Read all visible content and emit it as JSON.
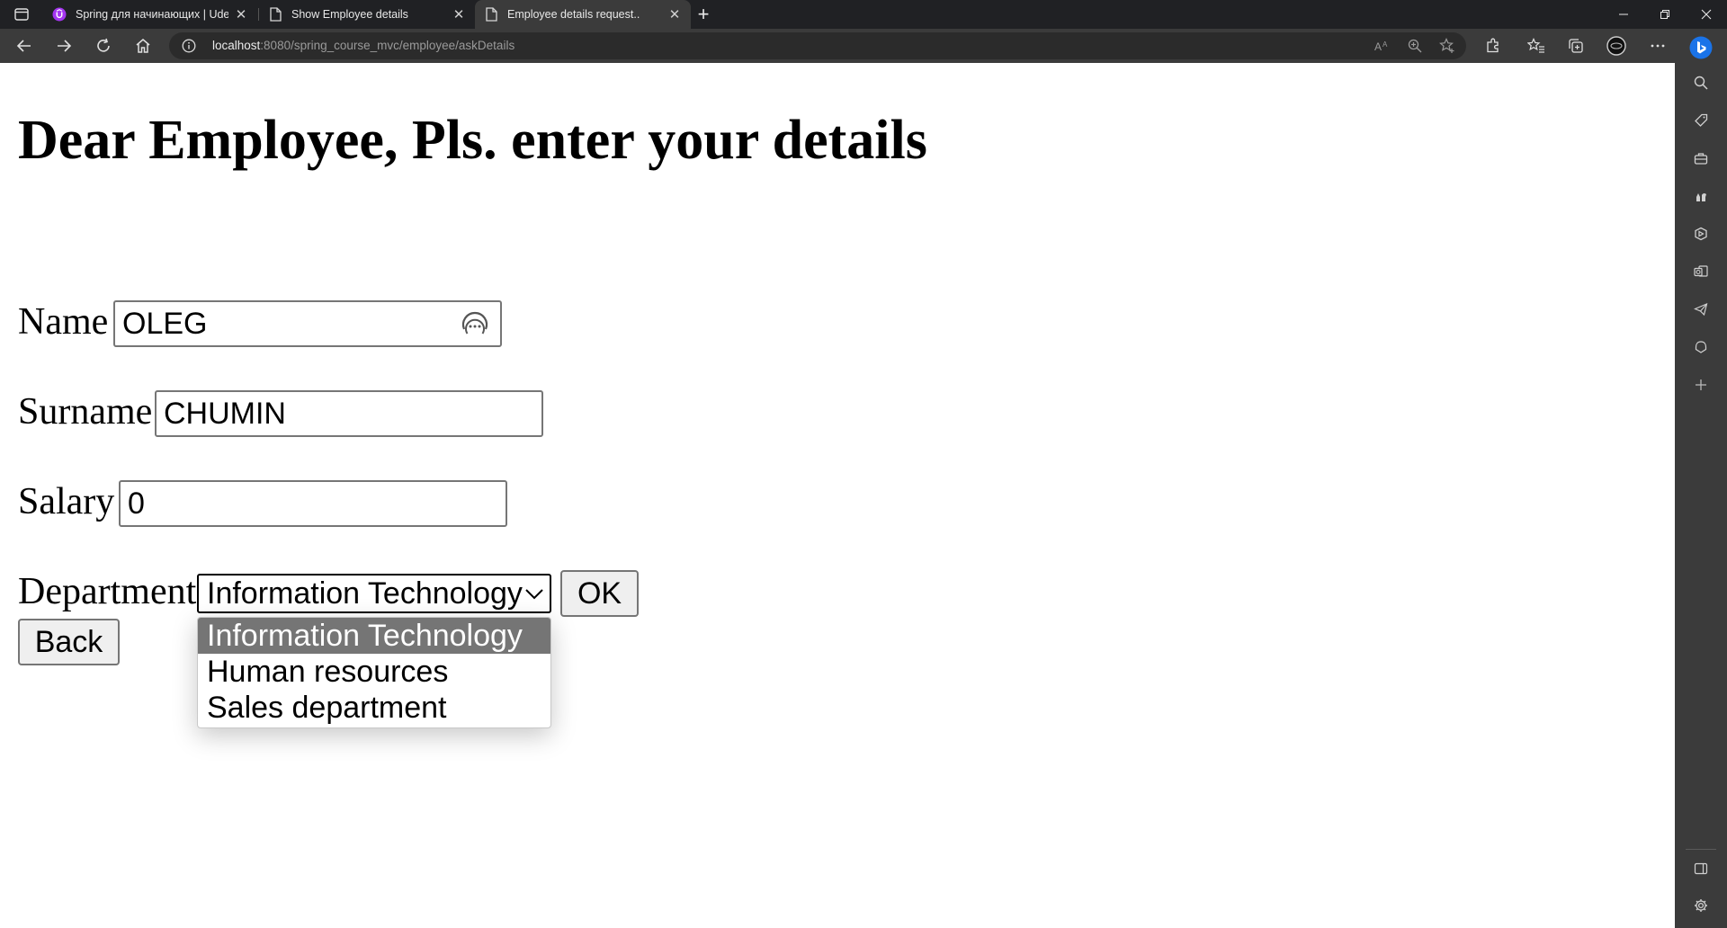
{
  "browser": {
    "tabs": [
      {
        "title": "Spring для начинающих | Udem",
        "favicon": "udemy-icon",
        "active": false
      },
      {
        "title": "Show Employee details",
        "favicon": "page-icon",
        "active": false
      },
      {
        "title": "Employee details request..",
        "favicon": "page-icon",
        "active": true
      }
    ],
    "address": {
      "host": "localhost",
      "rest": ":8080/spring_course_mvc/employee/askDetails"
    },
    "accent_color": "#1a73e8"
  },
  "page": {
    "heading": "Dear Employee, Pls. enter your details",
    "form": {
      "name_label": "Name",
      "name_value": "OLEG",
      "surname_label": "Surname",
      "surname_value": "CHUMIN",
      "salary_label": "Salary",
      "salary_value": "0",
      "department_label": "Department",
      "department_selected": "Information Technology",
      "department_options": [
        "Information Technology",
        "Human resources",
        "Sales department"
      ],
      "ok_label": "OK",
      "back_label": "Back"
    }
  }
}
